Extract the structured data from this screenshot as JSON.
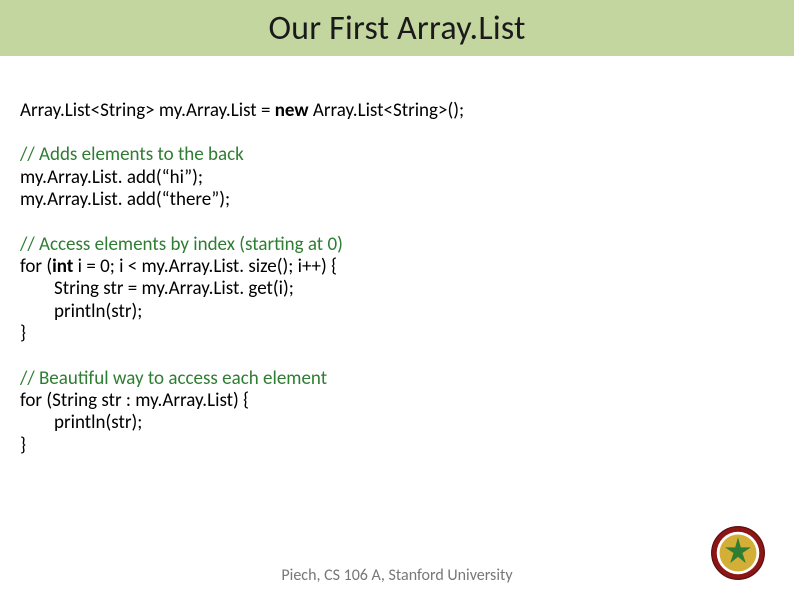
{
  "slide": {
    "title": "Our First Array.List",
    "footer": "Piech, CS 106 A, Stanford University"
  },
  "code": {
    "decl_pre": "Array.List<String> my.Array.List = ",
    "decl_kw": "new",
    "decl_post": " Array.List<String>();",
    "b1_comment": "// Adds elements to the back",
    "b1_l1": "my.Array.List. add(“hi”);",
    "b1_l2": "my.Array.List. add(“there”);",
    "b2_comment": "// Access elements by index (starting at 0)",
    "b2_l1_pre": "for (",
    "b2_l1_kw": "int",
    "b2_l1_post": " i = 0; i < my.Array.List. size(); i++) {",
    "b2_l2": "String str = my.Array.List. get(i);",
    "b2_l3": "println(str);",
    "b2_l4": "}",
    "b3_comment": "// Beautiful way to access each element",
    "b3_l1": "for (String str : my.Array.List) {",
    "b3_l2": "println(str);",
    "b3_l3": "}"
  },
  "seal": {
    "name": "stanford-seal",
    "ring_color": "#8c1515",
    "inner_color": "#d4af37",
    "accent_color": "#2e7d32"
  }
}
